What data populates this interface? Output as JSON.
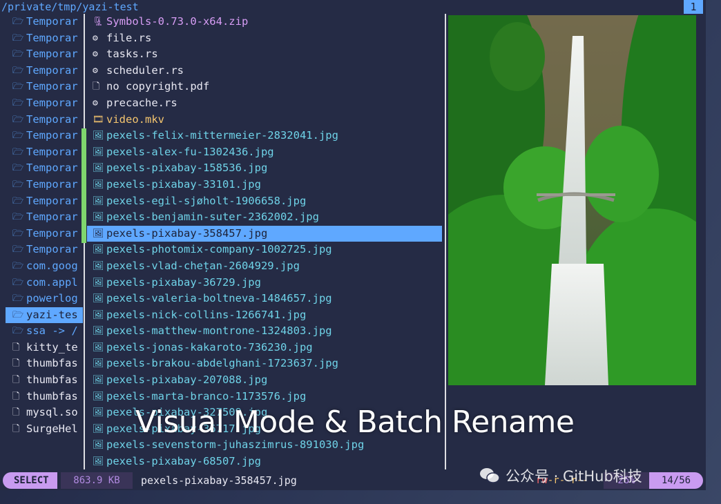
{
  "header": {
    "path": "/private/tmp/yazi-test",
    "tab": "1"
  },
  "parent": [
    {
      "label": "Temporar",
      "icon": "folder-icon",
      "type": "dir"
    },
    {
      "label": "Temporar",
      "icon": "folder-icon",
      "type": "dir"
    },
    {
      "label": "Temporar",
      "icon": "folder-icon",
      "type": "dir"
    },
    {
      "label": "Temporar",
      "icon": "folder-icon",
      "type": "dir"
    },
    {
      "label": "Temporar",
      "icon": "folder-icon",
      "type": "dir"
    },
    {
      "label": "Temporar",
      "icon": "folder-icon",
      "type": "dir"
    },
    {
      "label": "Temporar",
      "icon": "folder-icon",
      "type": "dir"
    },
    {
      "label": "Temporar",
      "icon": "folder-icon",
      "type": "dir"
    },
    {
      "label": "Temporar",
      "icon": "folder-icon",
      "type": "dir"
    },
    {
      "label": "Temporar",
      "icon": "folder-icon",
      "type": "dir"
    },
    {
      "label": "Temporar",
      "icon": "folder-icon",
      "type": "dir"
    },
    {
      "label": "Temporar",
      "icon": "folder-icon",
      "type": "dir"
    },
    {
      "label": "Temporar",
      "icon": "folder-icon",
      "type": "dir"
    },
    {
      "label": "Temporar",
      "icon": "folder-icon",
      "type": "dir"
    },
    {
      "label": "Temporar",
      "icon": "folder-icon",
      "type": "dir"
    },
    {
      "label": "com.goog",
      "icon": "folder-icon",
      "type": "dir"
    },
    {
      "label": "com.appl",
      "icon": "folder-icon",
      "type": "dir"
    },
    {
      "label": "powerlog",
      "icon": "folder-icon",
      "type": "dir"
    },
    {
      "label": "yazi-tes",
      "icon": "folder-icon",
      "type": "dir",
      "selected": true
    },
    {
      "label": "ssa -> /",
      "icon": "folder-icon",
      "type": "dir"
    },
    {
      "label": "kitty_te",
      "icon": "file-icon",
      "type": "file"
    },
    {
      "label": "thumbfas",
      "icon": "file-icon",
      "type": "file"
    },
    {
      "label": "thumbfas",
      "icon": "file-icon",
      "type": "file"
    },
    {
      "label": "thumbfas",
      "icon": "file-icon",
      "type": "file"
    },
    {
      "label": "mysql.so",
      "icon": "file-icon",
      "type": "file"
    },
    {
      "label": "SurgeHel",
      "icon": "file-icon",
      "type": "file"
    }
  ],
  "files": [
    {
      "name": "Symbols-0.73.0-x64.zip",
      "icon": "archive-icon",
      "kind": "zip"
    },
    {
      "name": "file.rs",
      "icon": "rust-icon",
      "kind": "code"
    },
    {
      "name": "tasks.rs",
      "icon": "rust-icon",
      "kind": "code"
    },
    {
      "name": "scheduler.rs",
      "icon": "rust-icon",
      "kind": "code"
    },
    {
      "name": "no copyright.pdf",
      "icon": "pdf-icon",
      "kind": "doc"
    },
    {
      "name": "precache.rs",
      "icon": "rust-icon",
      "kind": "code"
    },
    {
      "name": "video.mkv",
      "icon": "video-icon",
      "kind": "vid"
    },
    {
      "name": "pexels-felix-mittermeier-2832041.jpg",
      "icon": "image-icon",
      "kind": "img"
    },
    {
      "name": "pexels-alex-fu-1302436.jpg",
      "icon": "image-icon",
      "kind": "img"
    },
    {
      "name": "pexels-pixabay-158536.jpg",
      "icon": "image-icon",
      "kind": "img"
    },
    {
      "name": "pexels-pixabay-33101.jpg",
      "icon": "image-icon",
      "kind": "img"
    },
    {
      "name": "pexels-egil-sjøholt-1906658.jpg",
      "icon": "image-icon",
      "kind": "img"
    },
    {
      "name": "pexels-benjamin-suter-2362002.jpg",
      "icon": "image-icon",
      "kind": "img"
    },
    {
      "name": "pexels-pixabay-358457.jpg",
      "icon": "image-icon",
      "kind": "img",
      "selected": true
    },
    {
      "name": "pexels-photomix-company-1002725.jpg",
      "icon": "image-icon",
      "kind": "img"
    },
    {
      "name": "pexels-vlad-chețan-2604929.jpg",
      "icon": "image-icon",
      "kind": "img"
    },
    {
      "name": "pexels-pixabay-36729.jpg",
      "icon": "image-icon",
      "kind": "img"
    },
    {
      "name": "pexels-valeria-boltneva-1484657.jpg",
      "icon": "image-icon",
      "kind": "img"
    },
    {
      "name": "pexels-nick-collins-1266741.jpg",
      "icon": "image-icon",
      "kind": "img"
    },
    {
      "name": "pexels-matthew-montrone-1324803.jpg",
      "icon": "image-icon",
      "kind": "img"
    },
    {
      "name": "pexels-jonas-kakaroto-736230.jpg",
      "icon": "image-icon",
      "kind": "img"
    },
    {
      "name": "pexels-brakou-abdelghani-1723637.jpg",
      "icon": "image-icon",
      "kind": "img"
    },
    {
      "name": "pexels-pixabay-207088.jpg",
      "icon": "image-icon",
      "kind": "img"
    },
    {
      "name": "pexels-marta-branco-1173576.jpg",
      "icon": "image-icon",
      "kind": "img"
    },
    {
      "name": "pexels-pixabay-327509.jpg",
      "icon": "image-icon",
      "kind": "img"
    },
    {
      "name": "pexels-pixabay-36717.jpg",
      "icon": "image-icon",
      "kind": "img"
    },
    {
      "name": "pexels-sevenstorm-juhaszimrus-891030.jpg",
      "icon": "image-icon",
      "kind": "img"
    },
    {
      "name": "pexels-pixabay-68507.jpg",
      "icon": "image-icon",
      "kind": "img"
    }
  ],
  "status": {
    "mode": "SELECT",
    "size": "863.9 KB",
    "filename": "pexels-pixabay-358457.jpg",
    "perm_a": "rw",
    "perm_b": "-r--r--",
    "percent": "26%",
    "position": "14/56"
  },
  "overlay": {
    "caption": "Visual Mode & Batch Rename",
    "watermark": "公众号 · GitHub科技"
  },
  "colors": {
    "accent": "#5fa8ff",
    "select_mode": "#c99bf0",
    "visual_bar": "#7fd66d",
    "image_text": "#6fd3e8"
  }
}
